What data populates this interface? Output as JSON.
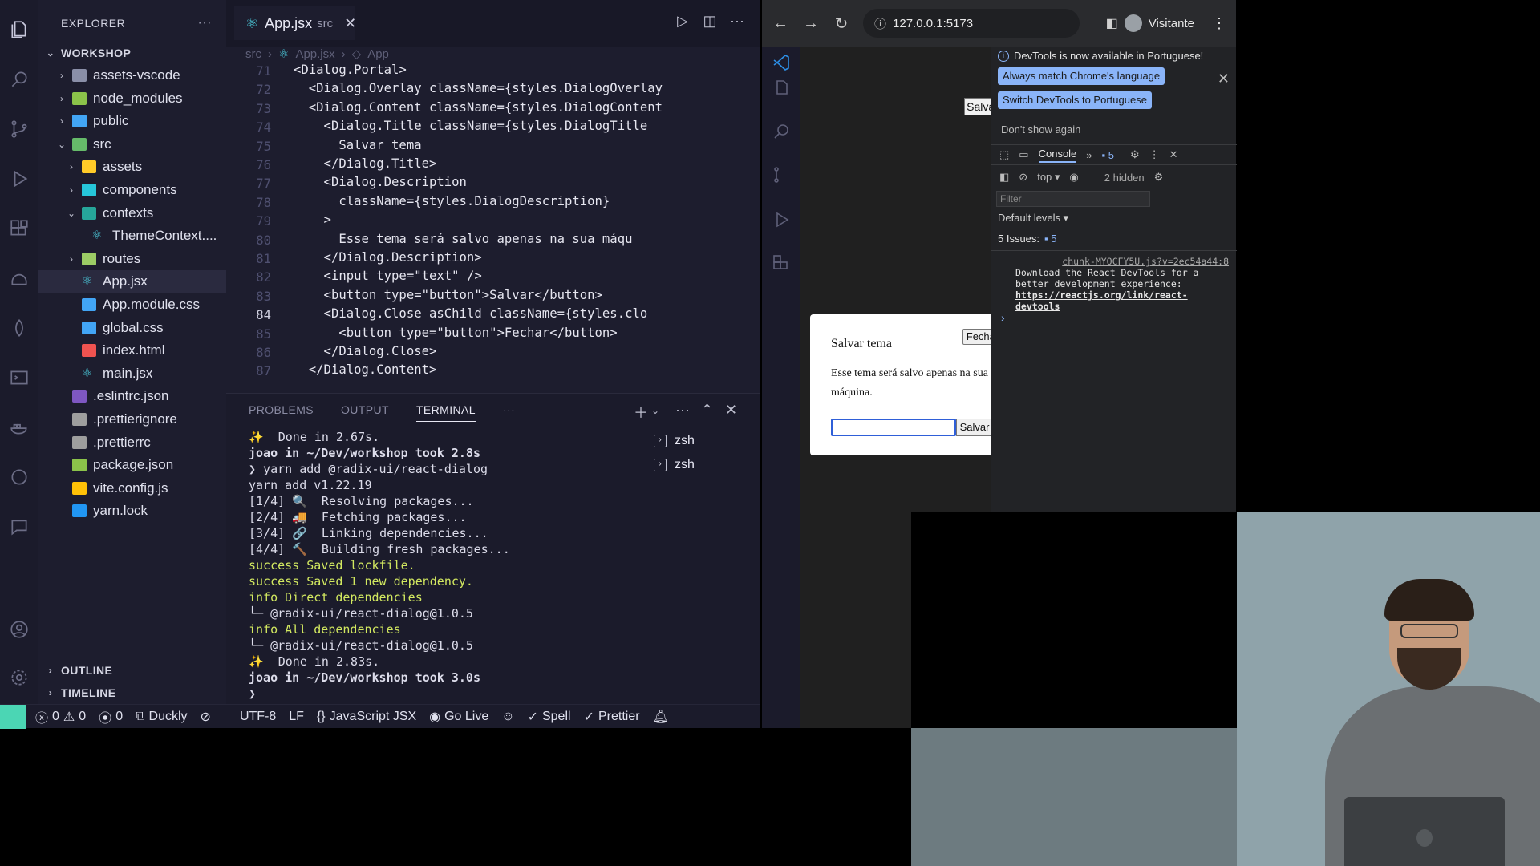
{
  "explorer": {
    "title": "EXPLORER",
    "workspace": "WORKSHOP",
    "items": [
      {
        "label": "assets-vscode",
        "kind": "folder",
        "color": "#8a8fa8"
      },
      {
        "label": "node_modules",
        "kind": "folder",
        "color": "#8bc34a"
      },
      {
        "label": "public",
        "kind": "folder",
        "color": "#42a5f5"
      },
      {
        "label": "src",
        "kind": "folder-open",
        "color": "#66bb6a"
      },
      {
        "label": "assets",
        "kind": "folder",
        "color": "#ffca28"
      },
      {
        "label": "components",
        "kind": "folder",
        "color": "#26c6da"
      },
      {
        "label": "contexts",
        "kind": "folder-open",
        "color": "#26a69a"
      },
      {
        "label": "ThemeContext....",
        "kind": "react",
        "color": "#4dd0e1"
      },
      {
        "label": "routes",
        "kind": "folder",
        "color": "#9ccc65"
      },
      {
        "label": "App.jsx",
        "kind": "react",
        "color": "#4dd0e1"
      },
      {
        "label": "App.module.css",
        "kind": "css",
        "color": "#42a5f5"
      },
      {
        "label": "global.css",
        "kind": "css",
        "color": "#42a5f5"
      },
      {
        "label": "index.html",
        "kind": "html",
        "color": "#ef5350"
      },
      {
        "label": "main.jsx",
        "kind": "react",
        "color": "#4dd0e1"
      },
      {
        "label": ".eslintrc.json",
        "kind": "eslint",
        "color": "#7e57c2"
      },
      {
        "label": ".prettierignore",
        "kind": "prettier",
        "color": "#9e9e9e"
      },
      {
        "label": ".prettierrc",
        "kind": "prettier",
        "color": "#9e9e9e"
      },
      {
        "label": "package.json",
        "kind": "json",
        "color": "#8bc34a"
      },
      {
        "label": "vite.config.js",
        "kind": "vite",
        "color": "#ffc107"
      },
      {
        "label": "yarn.lock",
        "kind": "yarn",
        "color": "#2196f3"
      }
    ],
    "outline": "OUTLINE",
    "timeline": "TIMELINE"
  },
  "editor": {
    "tab": {
      "name": "App.jsx",
      "dir": "src"
    },
    "breadcrumbs": [
      "src",
      "App.jsx",
      "App"
    ],
    "line_numbers": [
      "71",
      "72",
      "73",
      "74",
      "75",
      "76",
      "77",
      "78",
      "79",
      "80",
      "81",
      "82",
      "83",
      "84",
      "85",
      "86",
      "87"
    ],
    "current_line": "84",
    "code_lines": [
      "<Dialog.Portal>",
      "  <Dialog.Overlay className={styles.DialogOverlay",
      "  <Dialog.Content className={styles.DialogContent",
      "    <Dialog.Title className={styles.DialogTitle",
      "      Salvar tema",
      "    </Dialog.Title>",
      "    <Dialog.Description",
      "      className={styles.DialogDescription}",
      "    >",
      "      Esse tema será salvo apenas na sua máqu",
      "    </Dialog.Description>",
      "    <input type=\"text\" />",
      "    <button type=\"button\">Salvar</button>",
      "    <Dialog.Close asChild className={styles.clo",
      "      <button type=\"button\">Fechar</button>",
      "    </Dialog.Close>",
      "  </Dialog.Content>"
    ]
  },
  "panel": {
    "tabs": [
      "PROBLEMS",
      "OUTPUT",
      "TERMINAL"
    ],
    "active_tab": "TERMINAL",
    "terminal_lines": [
      "✨  Done in 2.67s.",
      "joao in ~/Dev/workshop took 2.8s",
      "❯ yarn add @radix-ui/react-dialog",
      "yarn add v1.22.19",
      "[1/4] 🔍  Resolving packages...",
      "[2/4] 🚚  Fetching packages...",
      "[3/4] 🔗  Linking dependencies...",
      "[4/4] 🔨  Building fresh packages...",
      "success Saved lockfile.",
      "success Saved 1 new dependency.",
      "info Direct dependencies",
      "└─ @radix-ui/react-dialog@1.0.5",
      "info All dependencies",
      "└─ @radix-ui/react-dialog@1.0.5",
      "✨  Done in 2.83s.",
      "joao in ~/Dev/workshop took 3.0s",
      "❯ "
    ],
    "terminals": [
      "zsh",
      "zsh"
    ]
  },
  "statusbar": {
    "errors": "0",
    "warnings": "0",
    "ports": "0",
    "duckly": "Duckly",
    "encoding": "UTF-8",
    "eol": "LF",
    "language": "JavaScript JSX",
    "golive": "Go Live",
    "spell": "Spell",
    "prettier": "Prettier"
  },
  "browser": {
    "url": "127.0.0.1:5173",
    "profile": "Visitante",
    "page": {
      "salvar_button": "Salvar",
      "dialog": {
        "title": "Salvar tema",
        "close": "Fechar",
        "description": "Esse tema será salvo apenas na sua máquina.",
        "input_value": "",
        "save": "Salvar"
      }
    },
    "devtools": {
      "info": "DevTools is now available in Portuguese!",
      "match_lang": "Always match Chrome's language",
      "switch_lang": "Switch DevTools to Portuguese",
      "dont_show": "Don't show again",
      "console_tab": "Console",
      "issues_badge": "5",
      "context": "top",
      "hidden": "2 hidden",
      "filter_placeholder": "Filter",
      "levels": "Default levels",
      "issues": "5 Issues:",
      "issues_count": "5",
      "log_source": "chunk-MYOCFY5U.js?v=2ec54a44:8",
      "log_text": "Download the React DevTools for a better development experience: ",
      "log_link": "https://reactjs.org/link/react-devtools"
    }
  }
}
